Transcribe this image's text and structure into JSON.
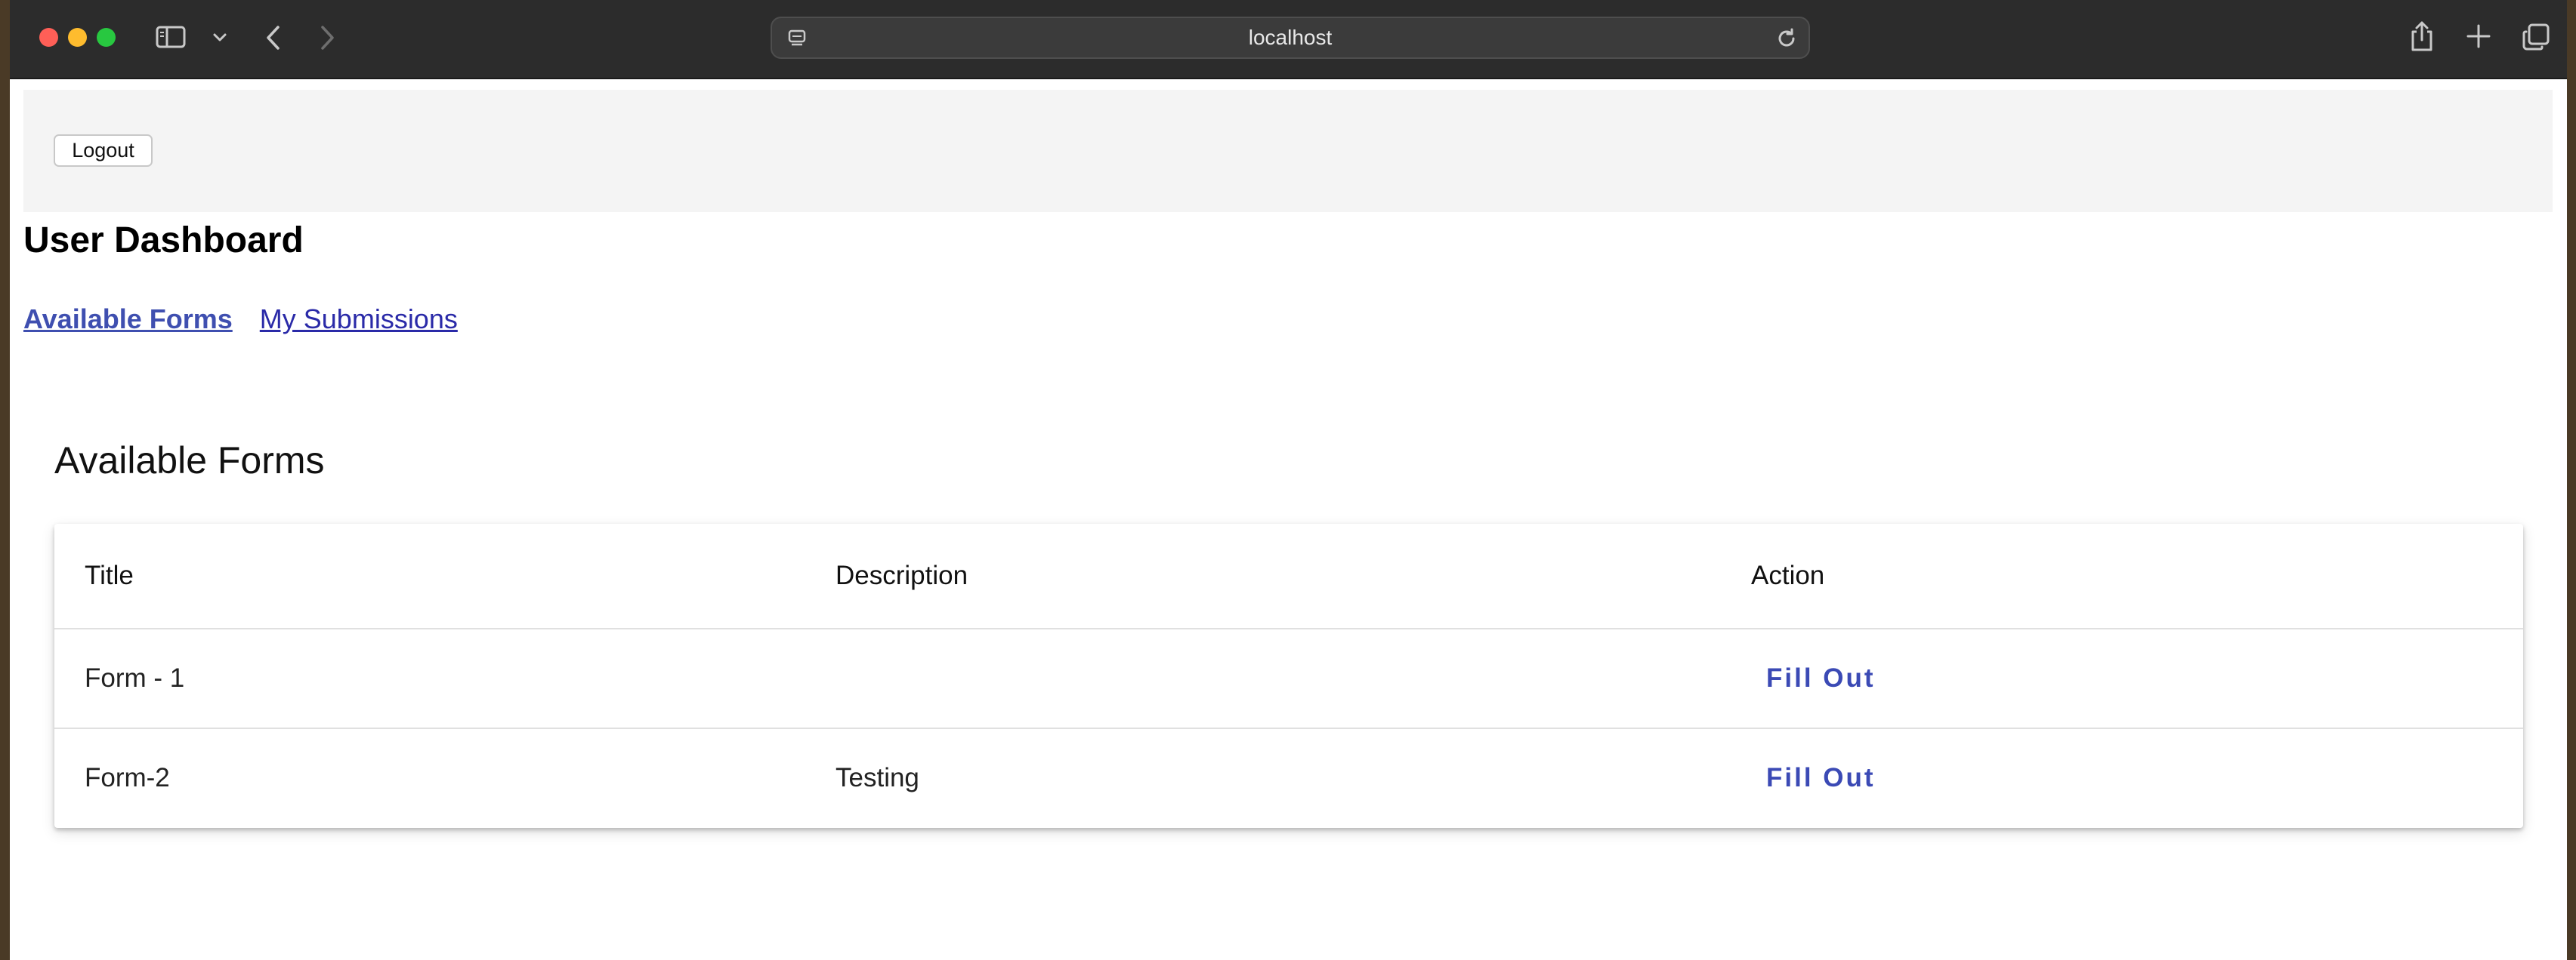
{
  "browser": {
    "url": "localhost",
    "icons": {
      "sidebar": "sidebar-icon",
      "chevron": "chevron-down-icon",
      "back": "back-arrow-icon",
      "forward": "forward-arrow-icon",
      "site": "site-info-icon",
      "reload": "reload-icon",
      "share": "share-icon",
      "new_tab": "plus-icon",
      "tabs": "tab-overview-icon"
    }
  },
  "header": {
    "logout_label": "Logout"
  },
  "page": {
    "title": "User Dashboard",
    "nav": [
      {
        "label": "Available Forms",
        "active": true
      },
      {
        "label": "My Submissions",
        "active": false
      }
    ]
  },
  "forms": {
    "title": "Available Forms",
    "columns": [
      "Title",
      "Description",
      "Action"
    ],
    "rows": [
      {
        "title": "Form - 1",
        "description": "",
        "action": "Fill Out"
      },
      {
        "title": "Form-2",
        "description": "Testing",
        "action": "Fill Out"
      }
    ]
  },
  "colors": {
    "link": "#2a2aa8",
    "active_link": "#3f4fb0",
    "action": "#3b4ab5",
    "topbar_bg": "#f4f4f4",
    "chrome_bg": "#2c2c2c"
  }
}
